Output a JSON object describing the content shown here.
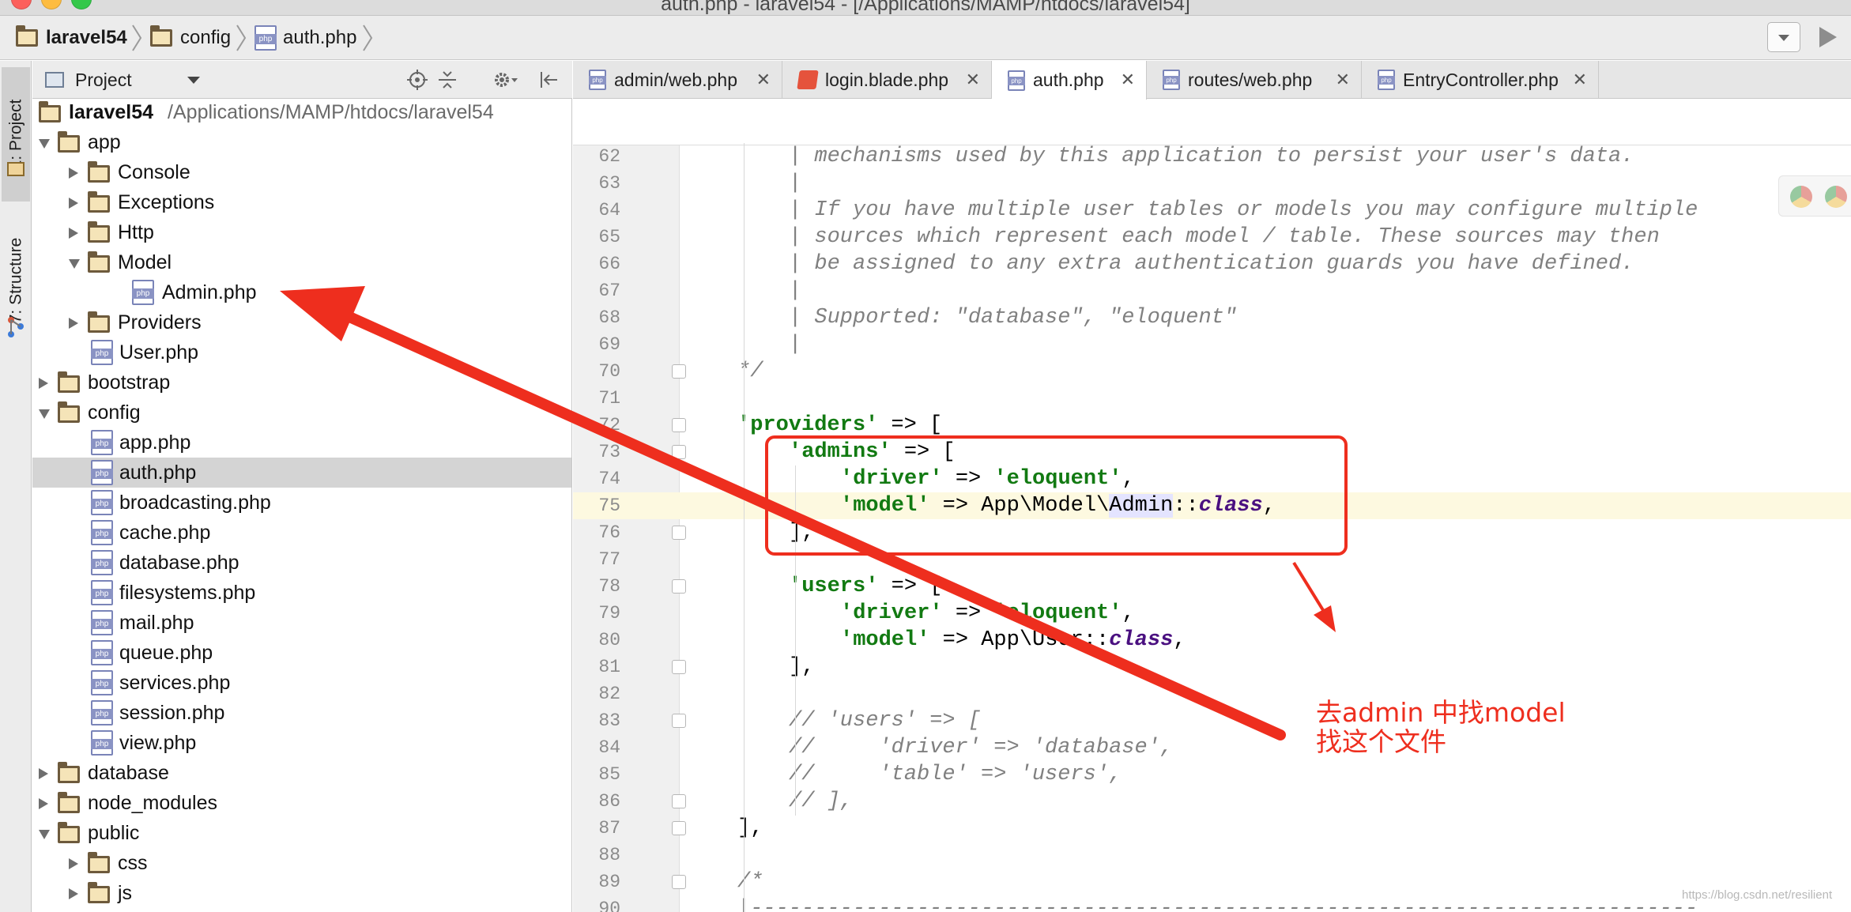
{
  "window": {
    "title": "auth.php - laravel54 - [/Applications/MAMP/htdocs/laravel54]"
  },
  "breadcrumb": {
    "items": [
      {
        "label": "laravel54",
        "icon": "folder-icon"
      },
      {
        "label": "config",
        "icon": "folder-icon"
      },
      {
        "label": "auth.php",
        "icon": "php-file-icon"
      }
    ]
  },
  "toolstrip": {
    "project_tab": "1: Project",
    "structure_tab": "7: Structure"
  },
  "project_panel": {
    "title": "Project",
    "tree": [
      {
        "label": "laravel54",
        "path": "/Applications/MAMP/htdocs/laravel54",
        "type": "folder",
        "depth": 0,
        "state": "root"
      },
      {
        "label": "app",
        "type": "folder",
        "depth": 0,
        "state": "open"
      },
      {
        "label": "Console",
        "type": "folder",
        "depth": 1,
        "state": "closed"
      },
      {
        "label": "Exceptions",
        "type": "folder",
        "depth": 1,
        "state": "closed"
      },
      {
        "label": "Http",
        "type": "folder",
        "depth": 1,
        "state": "closed"
      },
      {
        "label": "Model",
        "type": "folder",
        "depth": 1,
        "state": "open"
      },
      {
        "label": "Admin.php",
        "type": "php",
        "depth": 2,
        "state": "leaf"
      },
      {
        "label": "Providers",
        "type": "folder",
        "depth": 1,
        "state": "closed"
      },
      {
        "label": "User.php",
        "type": "php",
        "depth": 1,
        "state": "leaf"
      },
      {
        "label": "bootstrap",
        "type": "folder",
        "depth": 0,
        "state": "closed"
      },
      {
        "label": "config",
        "type": "folder",
        "depth": 0,
        "state": "open"
      },
      {
        "label": "app.php",
        "type": "php",
        "depth": 1,
        "state": "leaf"
      },
      {
        "label": "auth.php",
        "type": "php",
        "depth": 1,
        "state": "leaf",
        "selected": true
      },
      {
        "label": "broadcasting.php",
        "type": "php",
        "depth": 1,
        "state": "leaf"
      },
      {
        "label": "cache.php",
        "type": "php",
        "depth": 1,
        "state": "leaf"
      },
      {
        "label": "database.php",
        "type": "php",
        "depth": 1,
        "state": "leaf"
      },
      {
        "label": "filesystems.php",
        "type": "php",
        "depth": 1,
        "state": "leaf"
      },
      {
        "label": "mail.php",
        "type": "php",
        "depth": 1,
        "state": "leaf"
      },
      {
        "label": "queue.php",
        "type": "php",
        "depth": 1,
        "state": "leaf"
      },
      {
        "label": "services.php",
        "type": "php",
        "depth": 1,
        "state": "leaf"
      },
      {
        "label": "session.php",
        "type": "php",
        "depth": 1,
        "state": "leaf"
      },
      {
        "label": "view.php",
        "type": "php",
        "depth": 1,
        "state": "leaf"
      },
      {
        "label": "database",
        "type": "folder",
        "depth": 0,
        "state": "closed"
      },
      {
        "label": "node_modules",
        "type": "folder",
        "depth": 0,
        "state": "closed"
      },
      {
        "label": "public",
        "type": "folder",
        "depth": 0,
        "state": "open"
      },
      {
        "label": "css",
        "type": "folder",
        "depth": 1,
        "state": "closed"
      },
      {
        "label": "js",
        "type": "folder",
        "depth": 1,
        "state": "closed"
      }
    ]
  },
  "editor": {
    "tabs": [
      {
        "label": "admin/web.php",
        "icon": "php-file-icon",
        "active": false
      },
      {
        "label": "login.blade.php",
        "icon": "blade-file-icon",
        "active": false
      },
      {
        "label": "auth.php",
        "icon": "php-file-icon",
        "active": true
      },
      {
        "label": "routes/web.php",
        "icon": "php-file-icon",
        "active": false
      },
      {
        "label": "EntryController.php",
        "icon": "php-file-icon",
        "active": false
      }
    ],
    "current_line": 75,
    "lines": [
      {
        "num": "62",
        "indent": 1,
        "tokens": [
          {
            "t": "| mechanisms used by this application to persist your user's data.",
            "c": "comment"
          }
        ]
      },
      {
        "num": "63",
        "indent": 1,
        "tokens": [
          {
            "t": "|",
            "c": "comment"
          }
        ]
      },
      {
        "num": "64",
        "indent": 1,
        "tokens": [
          {
            "t": "| If you have multiple user tables or models you may configure multiple",
            "c": "comment"
          }
        ]
      },
      {
        "num": "65",
        "indent": 1,
        "tokens": [
          {
            "t": "| sources which represent each model / table. These sources may then",
            "c": "comment"
          }
        ]
      },
      {
        "num": "66",
        "indent": 1,
        "tokens": [
          {
            "t": "| be assigned to any extra authentication guards you have defined.",
            "c": "comment"
          }
        ]
      },
      {
        "num": "67",
        "indent": 1,
        "tokens": [
          {
            "t": "|",
            "c": "comment"
          }
        ]
      },
      {
        "num": "68",
        "indent": 1,
        "tokens": [
          {
            "t": "| Supported: \"database\", \"eloquent\"",
            "c": "comment"
          }
        ]
      },
      {
        "num": "69",
        "indent": 1,
        "tokens": [
          {
            "t": "|",
            "c": "comment"
          }
        ]
      },
      {
        "num": "70",
        "indent": 0,
        "tokens": [
          {
            "t": "*/",
            "c": "comment"
          }
        ]
      },
      {
        "num": "71",
        "indent": 0,
        "tokens": []
      },
      {
        "num": "72",
        "indent": 0,
        "tokens": [
          {
            "t": "'providers'",
            "c": "key"
          },
          {
            "t": " => [",
            "c": "plain"
          }
        ]
      },
      {
        "num": "73",
        "indent": 1,
        "tokens": [
          {
            "t": "'admins'",
            "c": "key"
          },
          {
            "t": " => [",
            "c": "plain"
          }
        ]
      },
      {
        "num": "74",
        "indent": 2,
        "tokens": [
          {
            "t": "'driver'",
            "c": "key"
          },
          {
            "t": " => ",
            "c": "plain"
          },
          {
            "t": "'eloquent'",
            "c": "key"
          },
          {
            "t": ",",
            "c": "plain"
          }
        ]
      },
      {
        "num": "75",
        "indent": 2,
        "tokens": [
          {
            "t": "'model'",
            "c": "key"
          },
          {
            "t": " => App\\Model\\",
            "c": "plain"
          },
          {
            "t": "Admin",
            "c": "hl"
          },
          {
            "t": "::",
            "c": "plain"
          },
          {
            "t": "class",
            "c": "kw"
          },
          {
            "t": ",",
            "c": "plain"
          }
        ]
      },
      {
        "num": "76",
        "indent": 1,
        "tokens": [
          {
            "t": "],",
            "c": "plain"
          }
        ]
      },
      {
        "num": "77",
        "indent": 0,
        "tokens": []
      },
      {
        "num": "78",
        "indent": 1,
        "tokens": [
          {
            "t": "'users'",
            "c": "key"
          },
          {
            "t": " => [",
            "c": "plain"
          }
        ]
      },
      {
        "num": "79",
        "indent": 2,
        "tokens": [
          {
            "t": "'driver'",
            "c": "key"
          },
          {
            "t": " => ",
            "c": "plain"
          },
          {
            "t": "'eloquent'",
            "c": "key"
          },
          {
            "t": ",",
            "c": "plain"
          }
        ]
      },
      {
        "num": "80",
        "indent": 2,
        "tokens": [
          {
            "t": "'model'",
            "c": "key"
          },
          {
            "t": " => App\\User::",
            "c": "plain"
          },
          {
            "t": "class",
            "c": "kw"
          },
          {
            "t": ",",
            "c": "plain"
          }
        ]
      },
      {
        "num": "81",
        "indent": 1,
        "tokens": [
          {
            "t": "],",
            "c": "plain"
          }
        ]
      },
      {
        "num": "82",
        "indent": 0,
        "tokens": []
      },
      {
        "num": "83",
        "indent": 1,
        "tokens": [
          {
            "t": "// 'users' => [",
            "c": "comment"
          }
        ]
      },
      {
        "num": "84",
        "indent": 1,
        "tokens": [
          {
            "t": "//     'driver' => 'database',",
            "c": "comment"
          }
        ]
      },
      {
        "num": "85",
        "indent": 1,
        "tokens": [
          {
            "t": "//     'table' => 'users',",
            "c": "comment"
          }
        ]
      },
      {
        "num": "86",
        "indent": 1,
        "tokens": [
          {
            "t": "// ],",
            "c": "comment"
          }
        ]
      },
      {
        "num": "87",
        "indent": 0,
        "tokens": [
          {
            "t": "],",
            "c": "plain"
          }
        ]
      },
      {
        "num": "88",
        "indent": 0,
        "tokens": []
      },
      {
        "num": "89",
        "indent": 0,
        "tokens": [
          {
            "t": "/*",
            "c": "comment"
          }
        ]
      },
      {
        "num": "90",
        "indent": 0,
        "tokens": [
          {
            "t": "|--------------------------------------------------------------------------",
            "c": "comment"
          }
        ]
      }
    ]
  },
  "annotation": {
    "line1": "去admin 中找model",
    "line2": "找这个文件"
  },
  "watermark": "https://blog.csdn.net/resilient",
  "colors": {
    "annotation_red": "#ee2e1e",
    "code_key_green": "#127a12",
    "code_keyword_purple": "#4a1080",
    "code_comment_gray": "#808080",
    "current_line": "#fdf9e0",
    "selection_gray": "#d4d4d4"
  }
}
